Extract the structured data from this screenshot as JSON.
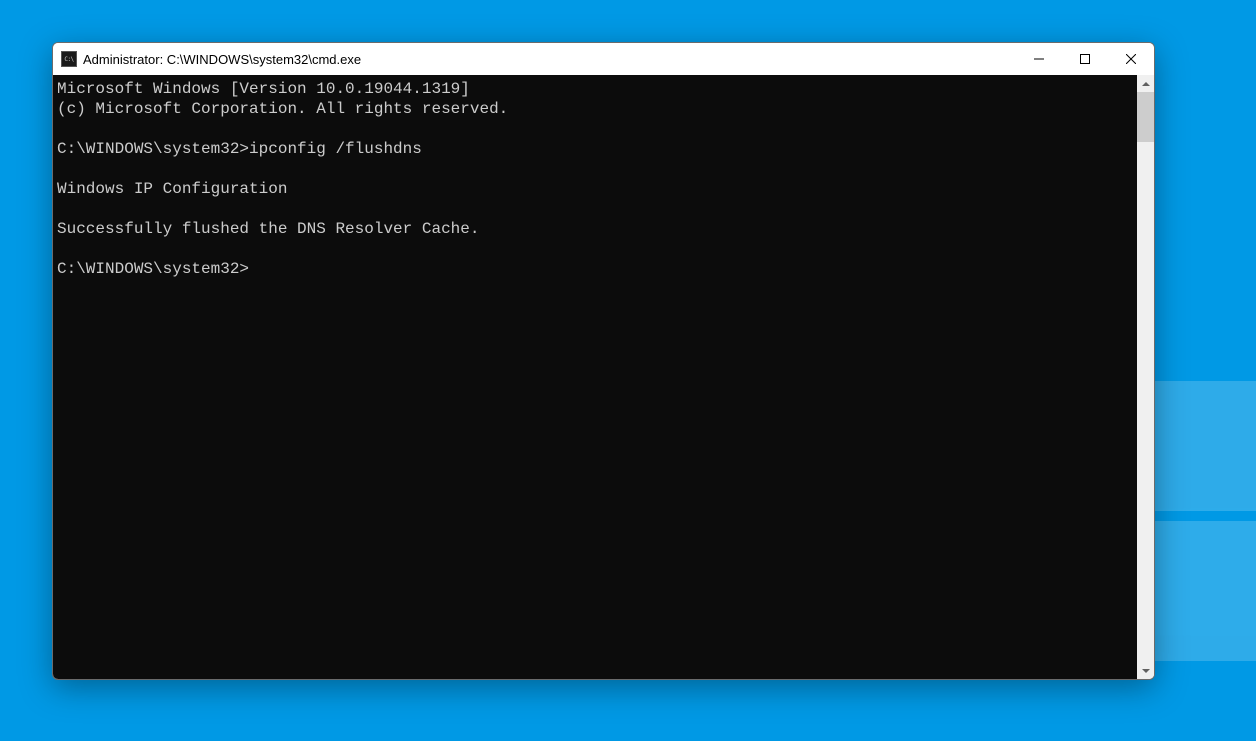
{
  "window": {
    "title": "Administrator: C:\\WINDOWS\\system32\\cmd.exe"
  },
  "terminal": {
    "lines": [
      "Microsoft Windows [Version 10.0.19044.1319]",
      "(c) Microsoft Corporation. All rights reserved.",
      "",
      "C:\\WINDOWS\\system32>ipconfig /flushdns",
      "",
      "Windows IP Configuration",
      "",
      "Successfully flushed the DNS Resolver Cache.",
      "",
      "C:\\WINDOWS\\system32>"
    ]
  }
}
